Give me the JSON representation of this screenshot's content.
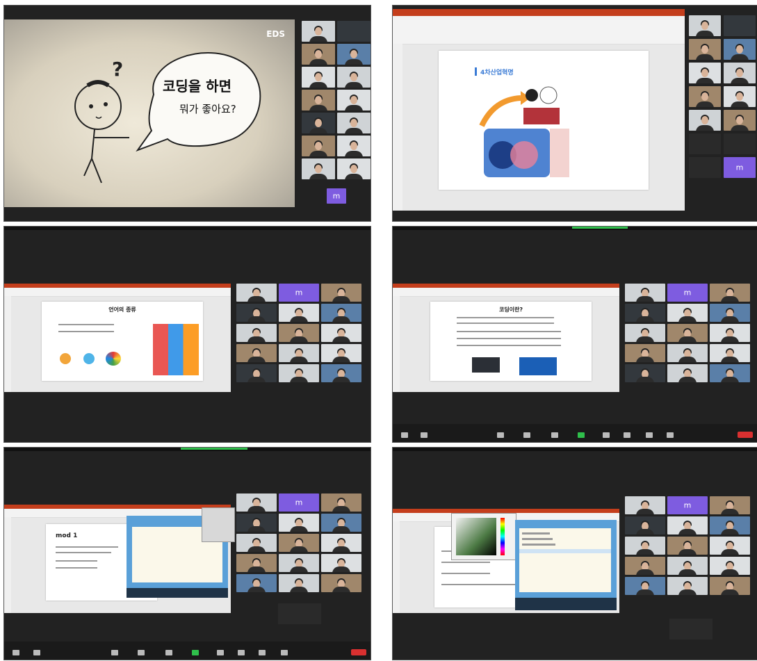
{
  "panel1": {
    "brand": "EDS",
    "bubble_line1": "코딩을 하면",
    "bubble_line2": "뭐가 좋아요?",
    "question_mark": "?",
    "avatar_letter": "m"
  },
  "panel2": {
    "slide_title": "4차산업혁명",
    "avatar_letter": "m"
  },
  "panel3": {
    "slide_title": "언어의 종류",
    "avatar_letter": "m"
  },
  "panel4": {
    "slide_title": "코딩이란?",
    "avatar_letter": "m"
  },
  "panel5": {
    "slide_title": "mod 1",
    "avatar_letter": "m"
  },
  "panel6": {
    "avatar_letter": "m"
  },
  "colors": {
    "background": "#222222",
    "accent_green": "#2fbf4b",
    "end_red": "#d93030",
    "ppt_red": "#c43e1c",
    "avatar_purple": "#7e5ce0"
  }
}
